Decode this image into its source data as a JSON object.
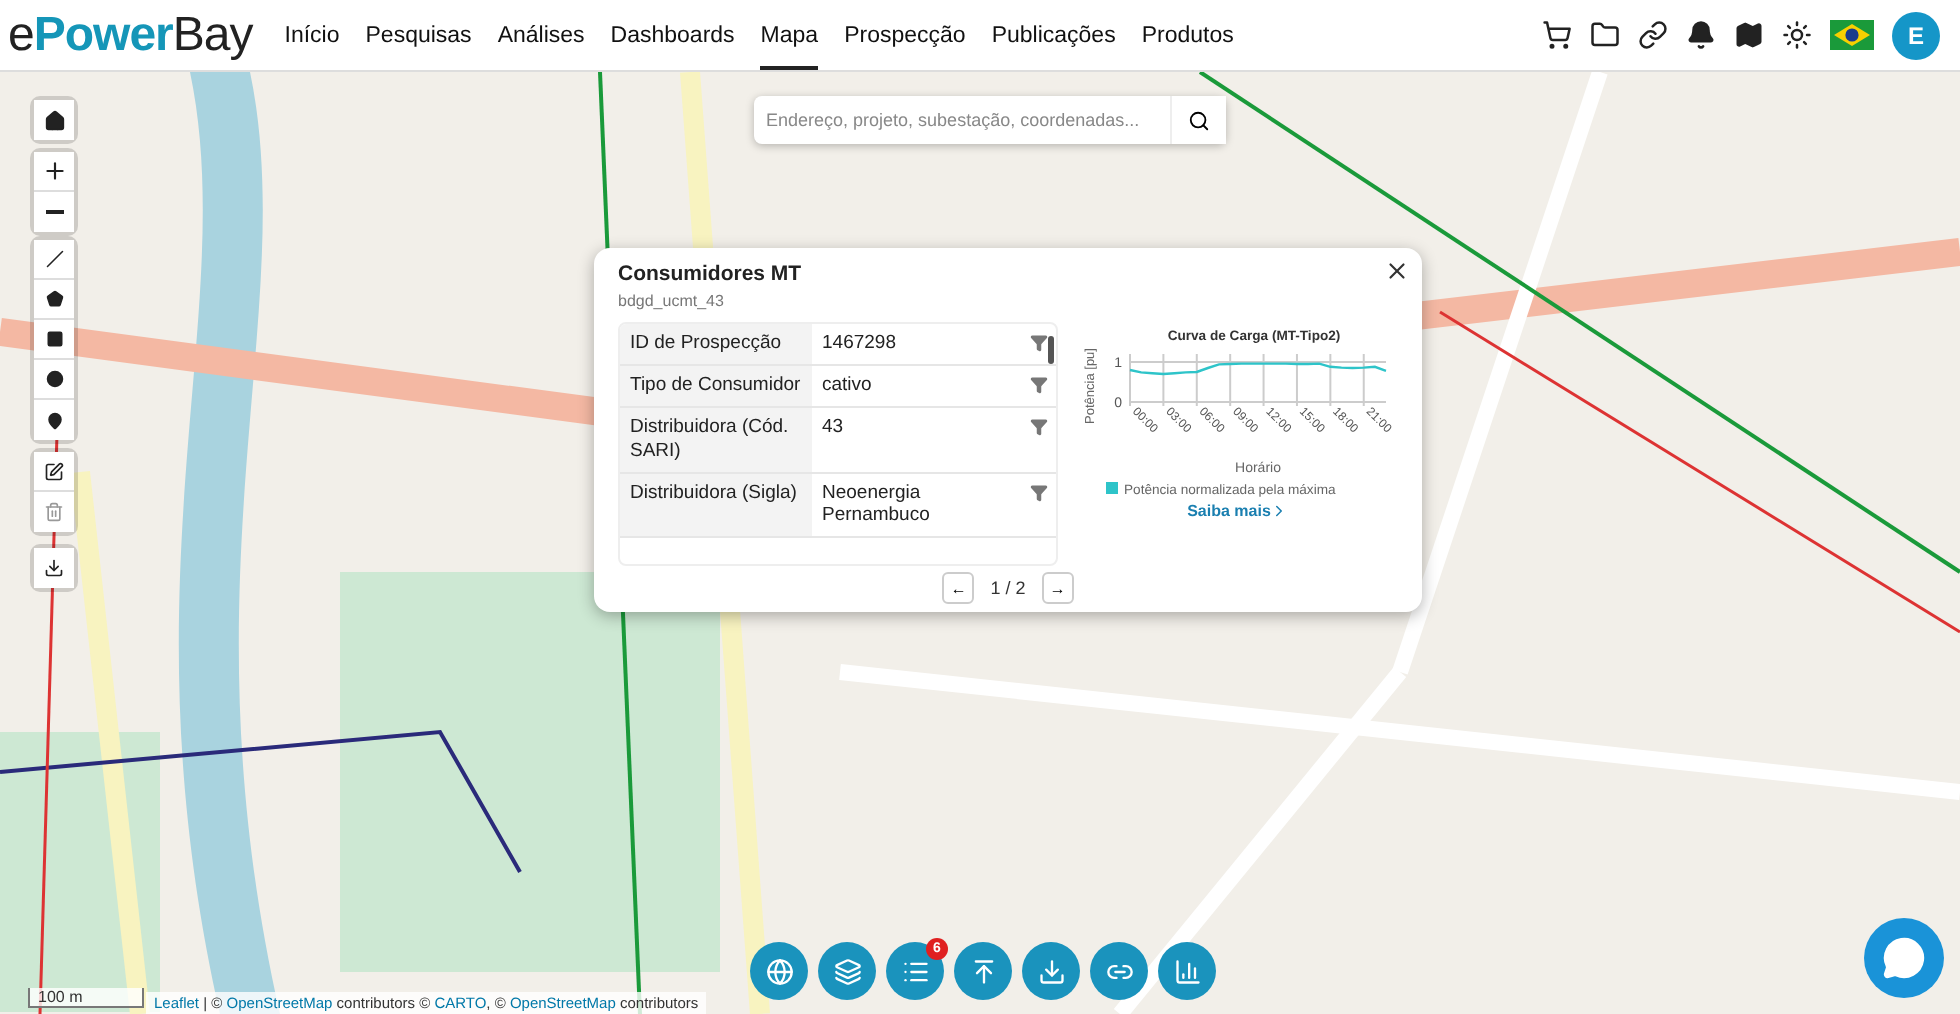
{
  "header": {
    "logo": {
      "prefix": "e",
      "highlight": "Power",
      "suffix": "Bay"
    },
    "nav": [
      {
        "label": "Início",
        "selected": false
      },
      {
        "label": "Pesquisas",
        "selected": false
      },
      {
        "label": "Análises",
        "selected": false
      },
      {
        "label": "Dashboards",
        "selected": false
      },
      {
        "label": "Mapa",
        "selected": true
      },
      {
        "label": "Prospecção",
        "selected": false
      },
      {
        "label": "Publicações",
        "selected": false
      },
      {
        "label": "Produtos",
        "selected": false
      }
    ],
    "avatar": "E"
  },
  "search": {
    "placeholder": "Endereço, projeto, subestação, coordenadas..."
  },
  "popup": {
    "title": "Consumidores MT",
    "subtitle": "bdgd_ucmt_43",
    "rows": [
      {
        "label": "ID de Prospecção",
        "value": "1467298"
      },
      {
        "label": "Tipo de Consumidor",
        "value": "cativo"
      },
      {
        "label": "Distribuidora (Cód. SARI)",
        "value": "43"
      },
      {
        "label": "Distribuidora (Sigla)",
        "value": "Neoenergia Pernambuco"
      }
    ],
    "chart_data": {
      "type": "line",
      "title": "Curva de Carga (MT-Tipo2)",
      "xlabel": "Horário",
      "ylabel": "Potência [pu]",
      "x": [
        0,
        1,
        2,
        3,
        4,
        5,
        6,
        7,
        8,
        9,
        10,
        11,
        12,
        13,
        14,
        15,
        16,
        17,
        18,
        19,
        20,
        21,
        22,
        23
      ],
      "series": [
        {
          "name": "Potência normalizada pela máxima",
          "color": "#2ec4c9",
          "values": [
            0.8,
            0.74,
            0.72,
            0.7,
            0.72,
            0.74,
            0.75,
            0.85,
            0.94,
            0.95,
            0.96,
            0.96,
            0.96,
            0.96,
            0.96,
            0.95,
            0.95,
            0.96,
            0.88,
            0.86,
            0.85,
            0.86,
            0.88,
            0.78
          ]
        }
      ],
      "ylim": [
        0,
        1.2
      ],
      "xlim": [
        0,
        23
      ],
      "yticks": [
        0,
        1
      ],
      "grid": true,
      "xticks": [
        {
          "value": 0,
          "label": "00:00"
        },
        {
          "value": 3,
          "label": "03:00"
        },
        {
          "value": 6,
          "label": "06:00"
        },
        {
          "value": 9,
          "label": "09:00"
        },
        {
          "value": 12,
          "label": "12:00"
        },
        {
          "value": 15,
          "label": "15:00"
        },
        {
          "value": 18,
          "label": "18:00"
        },
        {
          "value": 21,
          "label": "21:00"
        }
      ]
    },
    "link": "Saiba mais",
    "pager": {
      "prev": "←",
      "page": "1 / 2",
      "next": "→"
    }
  },
  "toolbar": {
    "list_badge": "6"
  },
  "scale": "100 m",
  "attribution": [
    {
      "text": "Leaflet",
      "link": true
    },
    {
      "text": " | © ",
      "link": false
    },
    {
      "text": "OpenStreetMap",
      "link": true
    },
    {
      "text": " contributors © ",
      "link": false
    },
    {
      "text": "CARTO",
      "link": true
    },
    {
      "text": ", © ",
      "link": false
    },
    {
      "text": "OpenStreetMap",
      "link": true
    },
    {
      "text": " contributors",
      "link": false
    }
  ]
}
